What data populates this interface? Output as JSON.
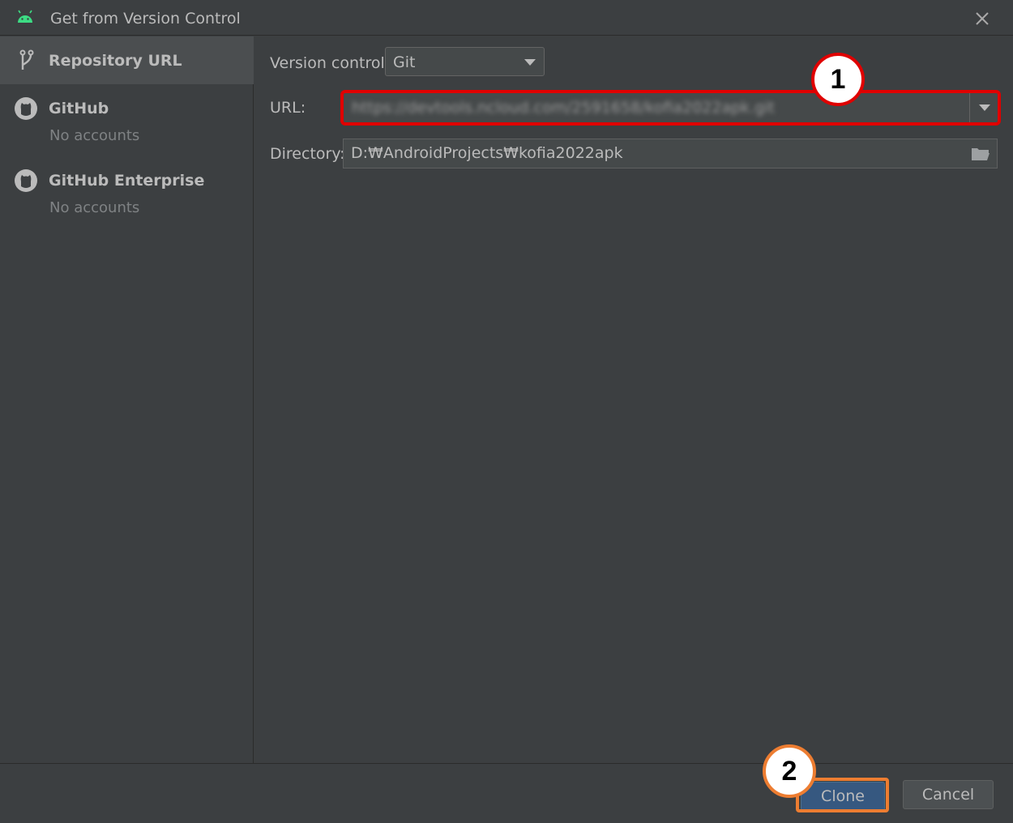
{
  "window": {
    "title": "Get from Version Control",
    "icon": "android-icon",
    "close_icon": "close-icon"
  },
  "sidebar": {
    "items": [
      {
        "label": "Repository URL",
        "icon": "vcs-branch-icon",
        "selected": true
      },
      {
        "label": "GitHub",
        "sublabel": "No accounts",
        "icon": "github-icon"
      },
      {
        "label": "GitHub Enterprise",
        "sublabel": "No accounts",
        "icon": "github-icon"
      }
    ]
  },
  "form": {
    "version_control_label": "Version control:",
    "version_control_value": "Git",
    "url_label": "URL:",
    "url_value": "https://devtools.ncloud.com/2591658/kofia2022apk.git",
    "directory_label": "Directory:",
    "directory_value": "D:₩AndroidProjects₩kofia2022apk"
  },
  "footer": {
    "clone_label": "Clone",
    "cancel_label": "Cancel"
  },
  "annotations": {
    "callout_1": "1",
    "callout_2": "2"
  },
  "colors": {
    "background": "#3c3f41",
    "selected_row": "#4b4e50",
    "field_bg": "#45494a",
    "primary_button": "#365880",
    "callout_red": "#e00000",
    "callout_orange": "#ed7d31",
    "android_green": "#3ddc84"
  }
}
